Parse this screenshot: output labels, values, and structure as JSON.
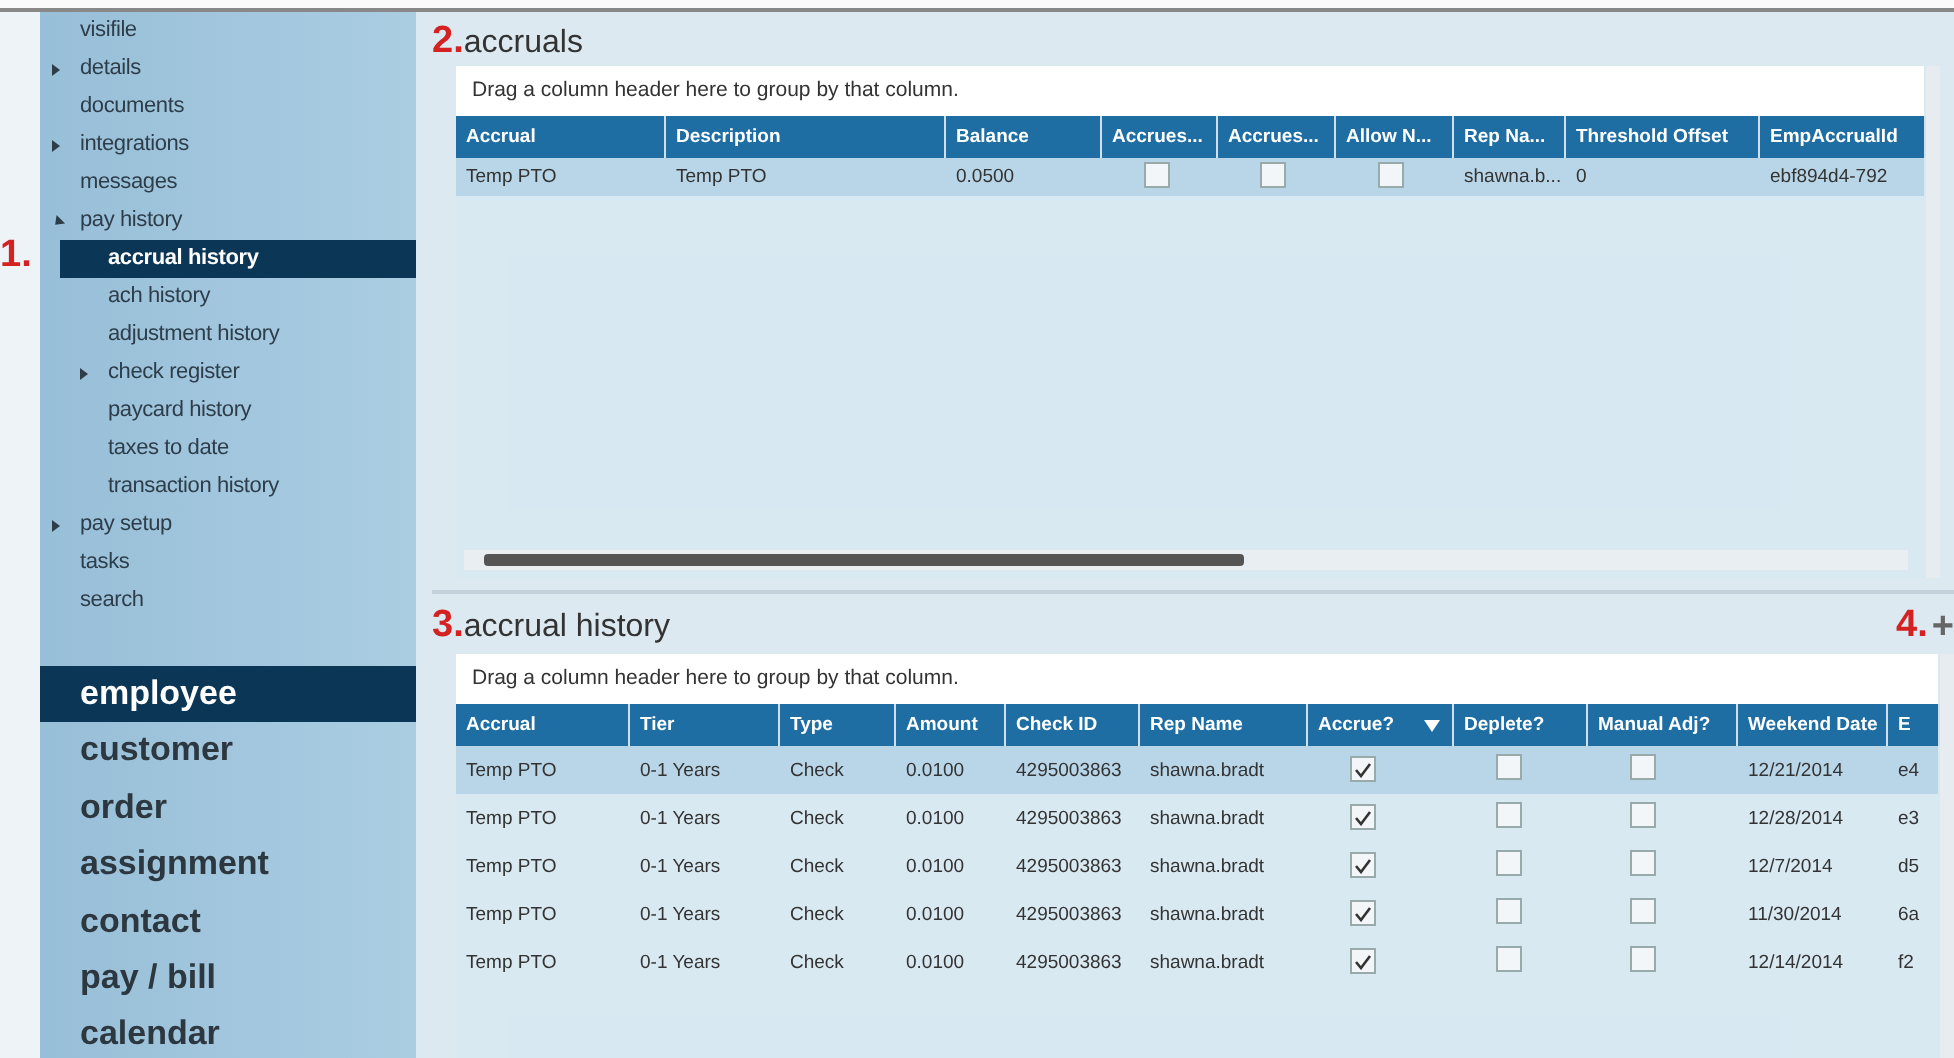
{
  "sidebar": {
    "tree": [
      {
        "label": "visifile",
        "selected": false
      },
      {
        "label": "details",
        "selected": false,
        "expanded": false
      },
      {
        "label": "documents",
        "selected": false
      },
      {
        "label": "integrations",
        "selected": false,
        "expanded": false
      },
      {
        "label": "messages",
        "selected": false
      },
      {
        "label": "pay history",
        "selected": false,
        "expanded": true,
        "children": [
          {
            "label": "accrual history",
            "selected": true,
            "marker": "1."
          },
          {
            "label": "ach history",
            "selected": false
          },
          {
            "label": "adjustment history",
            "selected": false
          },
          {
            "label": "check register",
            "selected": false,
            "expanded": false
          },
          {
            "label": "paycard history",
            "selected": false
          },
          {
            "label": "taxes to date",
            "selected": false
          },
          {
            "label": "transaction history",
            "selected": false
          }
        ]
      },
      {
        "label": "pay setup",
        "selected": false,
        "expanded": false
      },
      {
        "label": "tasks",
        "selected": false
      },
      {
        "label": "search",
        "selected": false
      }
    ],
    "nav": [
      {
        "label": "employee",
        "selected": true
      },
      {
        "label": "customer",
        "selected": false
      },
      {
        "label": "order",
        "selected": false
      },
      {
        "label": "assignment",
        "selected": false
      },
      {
        "label": "contact",
        "selected": false
      },
      {
        "label": "pay / bill",
        "selected": false
      },
      {
        "label": "calendar",
        "selected": false
      }
    ]
  },
  "sections": [
    {
      "marker": "2.",
      "title": "accruals",
      "group_hint": "Drag a column header here to group by that column.",
      "columns": [
        {
          "label": "Accrual",
          "kind": "text"
        },
        {
          "label": "Description",
          "kind": "text"
        },
        {
          "label": "Balance",
          "kind": "text"
        },
        {
          "label": "Accrues...",
          "kind": "check"
        },
        {
          "label": "Accrues...",
          "kind": "check"
        },
        {
          "label": "Allow N...",
          "kind": "check"
        },
        {
          "label": "Rep Na...",
          "kind": "text"
        },
        {
          "label": "Threshold Offset",
          "kind": "text"
        },
        {
          "label": "EmpAccrualId",
          "kind": "text"
        }
      ],
      "rows": [
        {
          "selected": true,
          "cells": [
            "Temp PTO",
            "Temp PTO",
            "0.0500",
            false,
            false,
            false,
            "shawna.b...",
            "0",
            "ebf894d4-792"
          ]
        }
      ]
    },
    {
      "marker": "3.",
      "title": "accrual history",
      "add_marker": "4.",
      "add": "+",
      "group_hint": "Drag a column header here to group by that column.",
      "columns": [
        {
          "label": "Accrual",
          "kind": "text"
        },
        {
          "label": "Tier",
          "kind": "text"
        },
        {
          "label": "Type",
          "kind": "text"
        },
        {
          "label": "Amount",
          "kind": "text"
        },
        {
          "label": "Check ID",
          "kind": "text"
        },
        {
          "label": "Rep Name",
          "kind": "text"
        },
        {
          "label": "Accrue?",
          "kind": "check",
          "filter": true
        },
        {
          "label": "Deplete?",
          "kind": "check"
        },
        {
          "label": "Manual Adj?",
          "kind": "check"
        },
        {
          "label": "Weekend Date",
          "kind": "text"
        },
        {
          "label": "E",
          "kind": "text"
        }
      ],
      "rows": [
        {
          "selected": true,
          "cells": [
            "Temp PTO",
            "0-1 Years",
            "Check",
            "0.0100",
            "4295003863",
            "shawna.bradt",
            true,
            false,
            false,
            "12/21/2014",
            "e4"
          ]
        },
        {
          "selected": false,
          "cells": [
            "Temp PTO",
            "0-1 Years",
            "Check",
            "0.0100",
            "4295003863",
            "shawna.bradt",
            true,
            false,
            false,
            "12/28/2014",
            "e3"
          ]
        },
        {
          "selected": false,
          "cells": [
            "Temp PTO",
            "0-1 Years",
            "Check",
            "0.0100",
            "4295003863",
            "shawna.bradt",
            true,
            false,
            false,
            "12/7/2014",
            "d5"
          ]
        },
        {
          "selected": false,
          "cells": [
            "Temp PTO",
            "0-1 Years",
            "Check",
            "0.0100",
            "4295003863",
            "shawna.bradt",
            true,
            false,
            false,
            "11/30/2014",
            "6a"
          ]
        },
        {
          "selected": false,
          "cells": [
            "Temp PTO",
            "0-1 Years",
            "Check",
            "0.0100",
            "4295003863",
            "shawna.bradt",
            true,
            false,
            false,
            "12/14/2014",
            "f2"
          ]
        }
      ]
    }
  ]
}
